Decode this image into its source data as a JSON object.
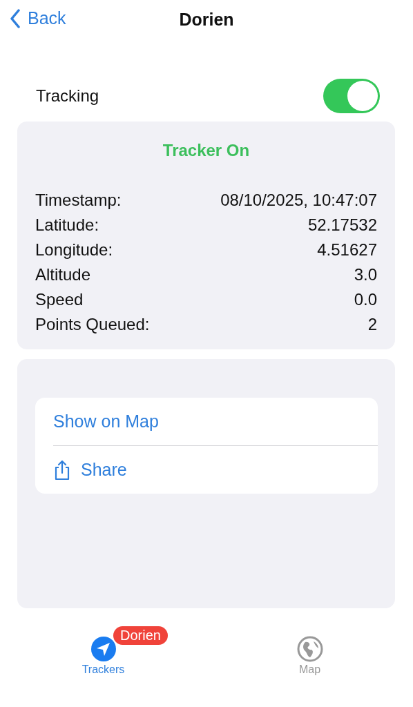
{
  "nav": {
    "back": "Back",
    "title": "Dorien"
  },
  "tracking": {
    "label": "Tracking",
    "on": true
  },
  "status": {
    "title": "Tracker On",
    "on": true,
    "rows": [
      {
        "label": "Timestamp:",
        "value": "08/10/2025, 10:47:07"
      },
      {
        "label": "Latitude:",
        "value": "52.17532"
      },
      {
        "label": "Longitude:",
        "value": "4.51627"
      },
      {
        "label": "Altitude",
        "value": "3.0"
      },
      {
        "label": "Speed",
        "value": "0.0"
      },
      {
        "label": "Points Queued:",
        "value": "2"
      }
    ]
  },
  "actions": [
    {
      "kind": "plain",
      "label": "Show on Map"
    },
    {
      "kind": "share",
      "label": "Share"
    }
  ],
  "tabs": [
    {
      "label": "Trackers",
      "selected": true,
      "badge": "Dorien"
    },
    {
      "label": "Map",
      "selected": false
    }
  ]
}
